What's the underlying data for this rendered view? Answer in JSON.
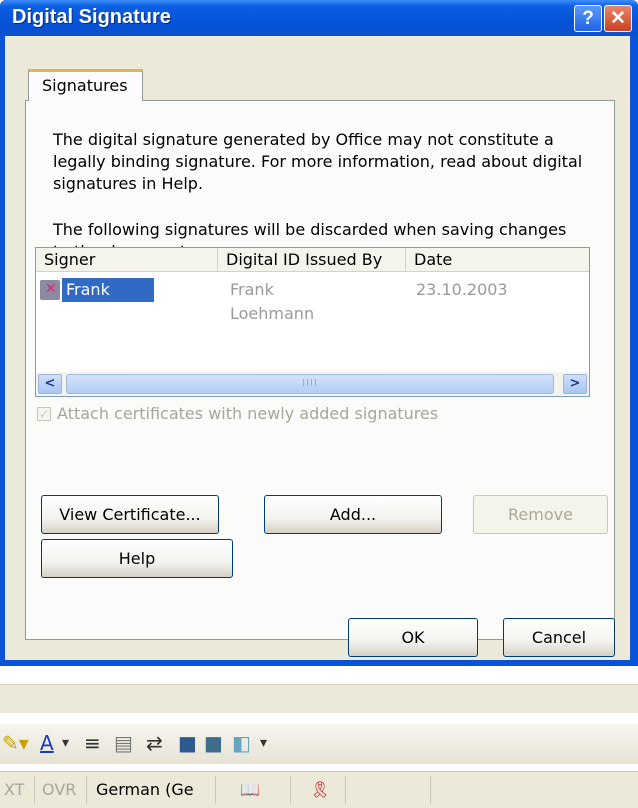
{
  "dialog": {
    "title": "Digital Signature",
    "help_glyph": "?",
    "close_glyph": "✕",
    "tab": "Signatures",
    "info_paragraph": "The digital signature generated by Office may not constitute a legally binding signature. For more information, read about digital signatures in Help.",
    "info_line1": "The digital signature generated by Office may not constitute a",
    "info_line2": "legally binding signature. For more information, read about digital",
    "info_line3": "signatures in Help.",
    "discard_line1": "The following signatures will be discarded when saving changes",
    "discard_line2": "to the document:",
    "columns": [
      "Signer",
      "Digital ID Issued By",
      "Date"
    ],
    "rows": [
      {
        "signer": "Frank Loehmann",
        "issued_by": "Frank Loehmann",
        "date": "23.10.2003"
      }
    ],
    "scroll_left": "<",
    "scroll_right": ">",
    "scroll_grip": "IIII",
    "attach_checkbox": {
      "label": "Attach certificates with newly added signatures",
      "checked": true,
      "enabled": false
    },
    "buttons": {
      "view_certificate": "View Certificate...",
      "add": "Add...",
      "remove": "Remove",
      "help": "Help",
      "ok": "OK",
      "cancel": "Cancel"
    }
  },
  "status_bar": {
    "ext": "XT",
    "ovr": "OVR",
    "language": "German (Ge"
  },
  "toolbar_icons": [
    "highlight-icon",
    "font-color-icon",
    "align-icon",
    "border-icon",
    "direction-icon",
    "shading-icon",
    "3d-icon"
  ],
  "colors": {
    "title_bar": "#0553d8",
    "selection": "#316ac5",
    "dialog_bg": "#ece9d8"
  }
}
